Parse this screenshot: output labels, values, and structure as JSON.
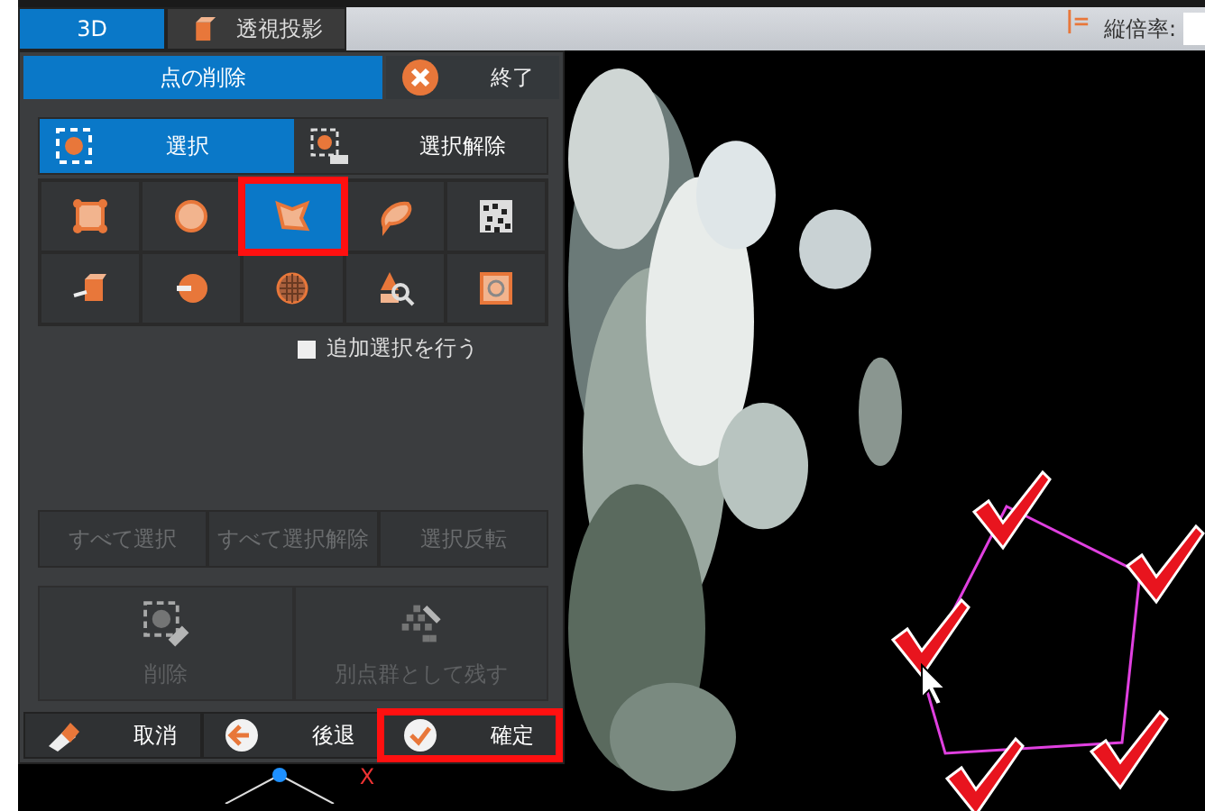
{
  "view_tabs": [
    {
      "label": "3D",
      "selected": true,
      "kind": "plain"
    },
    {
      "label": "透視投影",
      "selected": false,
      "kind": "cube"
    }
  ],
  "toolbar": {
    "scale_label": "縦倍率:"
  },
  "panel": {
    "title": "点の削除",
    "close_label": "終了",
    "modes": [
      {
        "label": "選択",
        "selected": true,
        "kind": "on"
      },
      {
        "label": "選択解除",
        "selected": false,
        "kind": "off"
      }
    ],
    "tools": [
      {
        "kind": "rectangle",
        "selected": false,
        "highlighted": false
      },
      {
        "kind": "circle",
        "selected": false,
        "highlighted": false
      },
      {
        "kind": "polygon",
        "selected": true,
        "highlighted": true
      },
      {
        "kind": "lasso",
        "selected": false,
        "highlighted": false
      },
      {
        "kind": "noise",
        "selected": false,
        "highlighted": false
      },
      {
        "kind": "box",
        "selected": false,
        "highlighted": false
      },
      {
        "kind": "cylinder",
        "selected": false,
        "highlighted": false
      },
      {
        "kind": "sphere",
        "selected": false,
        "highlighted": false
      },
      {
        "kind": "tree",
        "selected": false,
        "highlighted": false
      },
      {
        "kind": "frame",
        "selected": false,
        "highlighted": false
      }
    ],
    "additive": {
      "label": "追加選択を行う",
      "checked": false
    },
    "bulk_buttons": [
      {
        "label": "すべて選択",
        "disabled": true
      },
      {
        "label": "すべて選択解除",
        "disabled": true
      },
      {
        "label": "選択反転",
        "disabled": true
      }
    ],
    "actions": [
      {
        "label": "削除",
        "kind": "erase",
        "disabled": true
      },
      {
        "label": "別点群として残す",
        "kind": "split",
        "disabled": true
      }
    ],
    "footer": [
      {
        "label": "取消",
        "kind": "eraser",
        "highlighted": false
      },
      {
        "label": "後退",
        "kind": "back",
        "highlighted": false
      },
      {
        "label": "確定",
        "kind": "confirm",
        "highlighted": true
      }
    ]
  },
  "gizmo": {
    "axis_label": "X"
  }
}
